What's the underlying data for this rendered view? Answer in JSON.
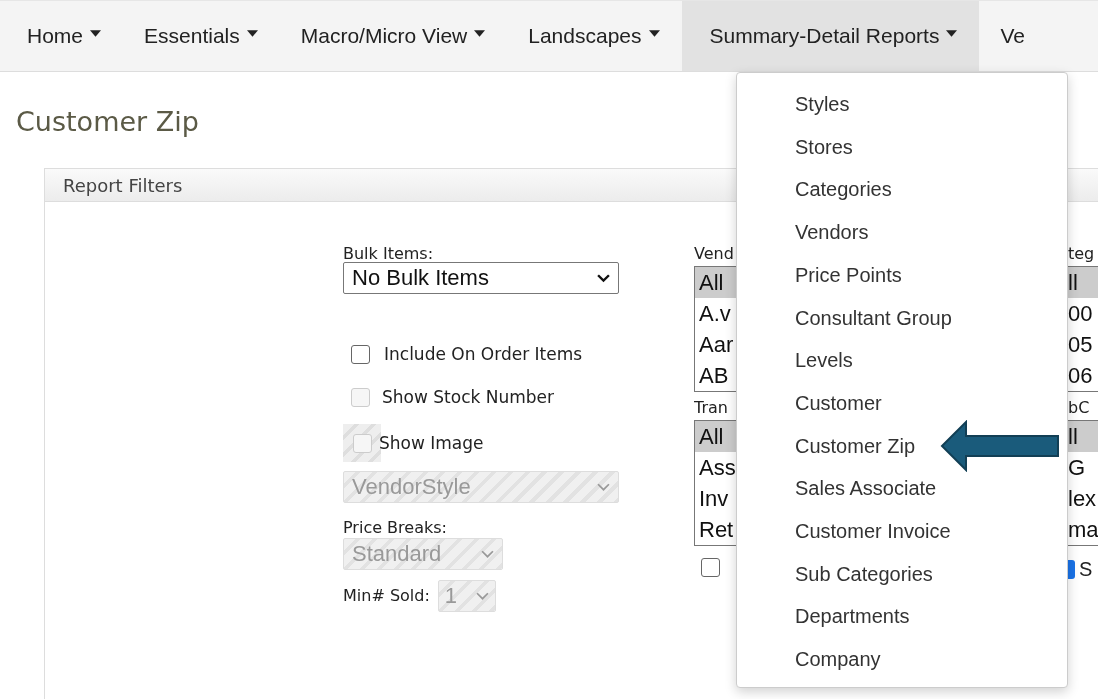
{
  "navbar": {
    "items": [
      {
        "label": "Home",
        "selected": false
      },
      {
        "label": "Essentials",
        "selected": false
      },
      {
        "label": "Macro/Micro View",
        "selected": false
      },
      {
        "label": "Landscapes",
        "selected": false
      },
      {
        "label": "Summary-Detail Reports",
        "selected": true
      },
      {
        "label": "Ve",
        "selected": false
      }
    ]
  },
  "page_title": "Customer Zip",
  "panel": {
    "title": "Report Filters"
  },
  "filters": {
    "bulk_label": "Bulk Items:",
    "bulk_value": "No Bulk Items",
    "checkboxes": [
      {
        "label": "Include On Order Items",
        "checked": false,
        "disabled": false
      },
      {
        "label": "Show Stock Number",
        "checked": false,
        "disabled": true
      },
      {
        "label": "Show Image",
        "checked": false,
        "disabled": true,
        "kind": "hatched"
      }
    ],
    "image_select": {
      "value": "VendorStyle",
      "disabled": true
    },
    "price_label": "Price Breaks:",
    "price_select": {
      "value": "Standard",
      "disabled": true
    },
    "min_label": "Min# Sold:",
    "min_select": {
      "value": "1",
      "disabled": true
    }
  },
  "column_2": {
    "lists": [
      {
        "label": "Vend",
        "options": [
          {
            "text": "All",
            "selected": true
          },
          {
            "text": "A.v",
            "selected": false
          },
          {
            "text": "Aar",
            "selected": false
          },
          {
            "text": "AB",
            "selected": false
          }
        ]
      },
      {
        "label": "Tran",
        "options": [
          {
            "text": "All",
            "selected": true
          },
          {
            "text": "Ass",
            "selected": false
          },
          {
            "text": "Inv",
            "selected": false
          },
          {
            "text": "Ret",
            "selected": false
          }
        ]
      }
    ],
    "checkbox": {
      "checked": false
    }
  },
  "column_3": {
    "lists": [
      {
        "label": "teg",
        "options": [
          {
            "text": "ll",
            "selected": true
          },
          {
            "text": "00",
            "selected": false
          },
          {
            "text": "05",
            "selected": false
          },
          {
            "text": "06",
            "selected": false
          }
        ]
      },
      {
        "label": "bC",
        "options": [
          {
            "text": "ll",
            "selected": true
          },
          {
            "text": "G",
            "selected": false
          },
          {
            "text": "lex",
            "selected": false
          },
          {
            "text": "ma",
            "selected": false
          }
        ]
      }
    ],
    "checkbox": {
      "checked": true,
      "label": "S"
    }
  },
  "dropdown_menu": {
    "items": [
      {
        "label": "Styles"
      },
      {
        "label": "Stores"
      },
      {
        "label": "Categories"
      },
      {
        "label": "Vendors"
      },
      {
        "label": "Price Points"
      },
      {
        "label": "Consultant Group"
      },
      {
        "label": "Levels"
      },
      {
        "label": "Customer"
      },
      {
        "label": "Customer Zip"
      },
      {
        "label": "Sales Associate"
      },
      {
        "label": "Customer Invoice"
      },
      {
        "label": "Sub Categories"
      },
      {
        "label": "Departments"
      },
      {
        "label": "Company"
      }
    ]
  }
}
